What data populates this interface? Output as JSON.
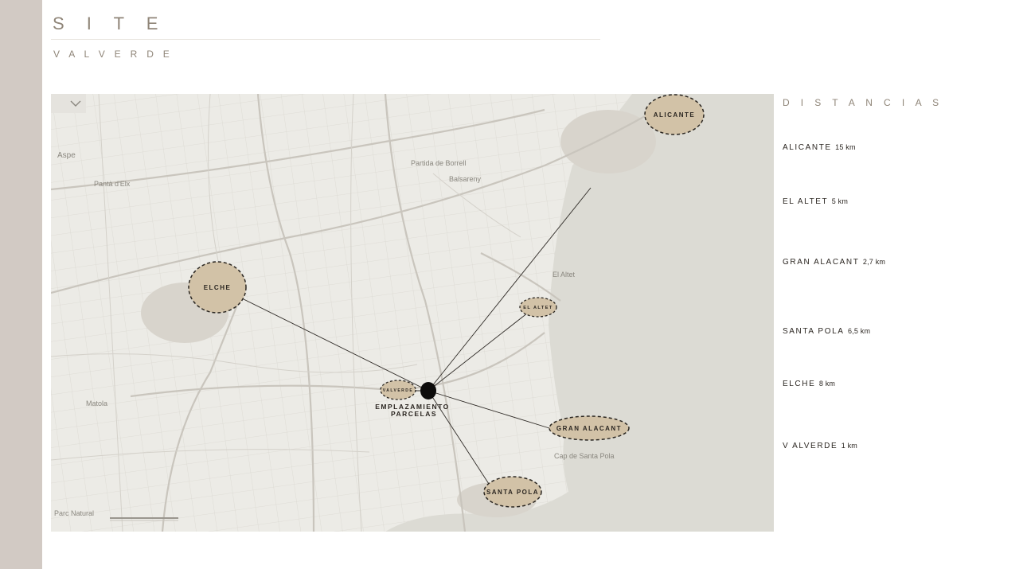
{
  "header": {
    "title": "S I T E",
    "subtitle": "V A L V E R D E"
  },
  "map": {
    "place_labels": [
      "Aspe",
      "Pantà d'Elx",
      "Partida de Borrell",
      "Balsareny",
      "El Altet",
      "Matola",
      "Parc Natural",
      "Cap de Santa Pola"
    ],
    "nodes": {
      "alicante": "ALICANTE",
      "el_altet": "EL ALTET",
      "gran_alacant": "GRAN ALACANT",
      "santa_pola": "SANTA POLA",
      "elche": "ELCHE",
      "valverde": "VALVERDE"
    },
    "site_label": [
      "EMPLAZAMIENTO",
      "PARCELAS"
    ],
    "colors": {
      "bubble_fill": "#d2c2a7",
      "bubble_stroke": "#2a2621",
      "land": "#ecebe6",
      "sea": "#dcdbd4",
      "side_band": "#d2cac4"
    }
  },
  "distances": {
    "title": "D I S T A N C I A S",
    "items": [
      {
        "name": "ALICANTE",
        "km": "15 km"
      },
      {
        "name": "EL ALTET",
        "km": "5 km"
      },
      {
        "name": "GRAN ALACANT",
        "km": "2,7 km"
      },
      {
        "name": "SANTA POLA",
        "km": "6,5 km"
      },
      {
        "name": "ELCHE",
        "km": "8 km"
      },
      {
        "name": "V ALVERDE",
        "km": "1 km"
      }
    ]
  }
}
